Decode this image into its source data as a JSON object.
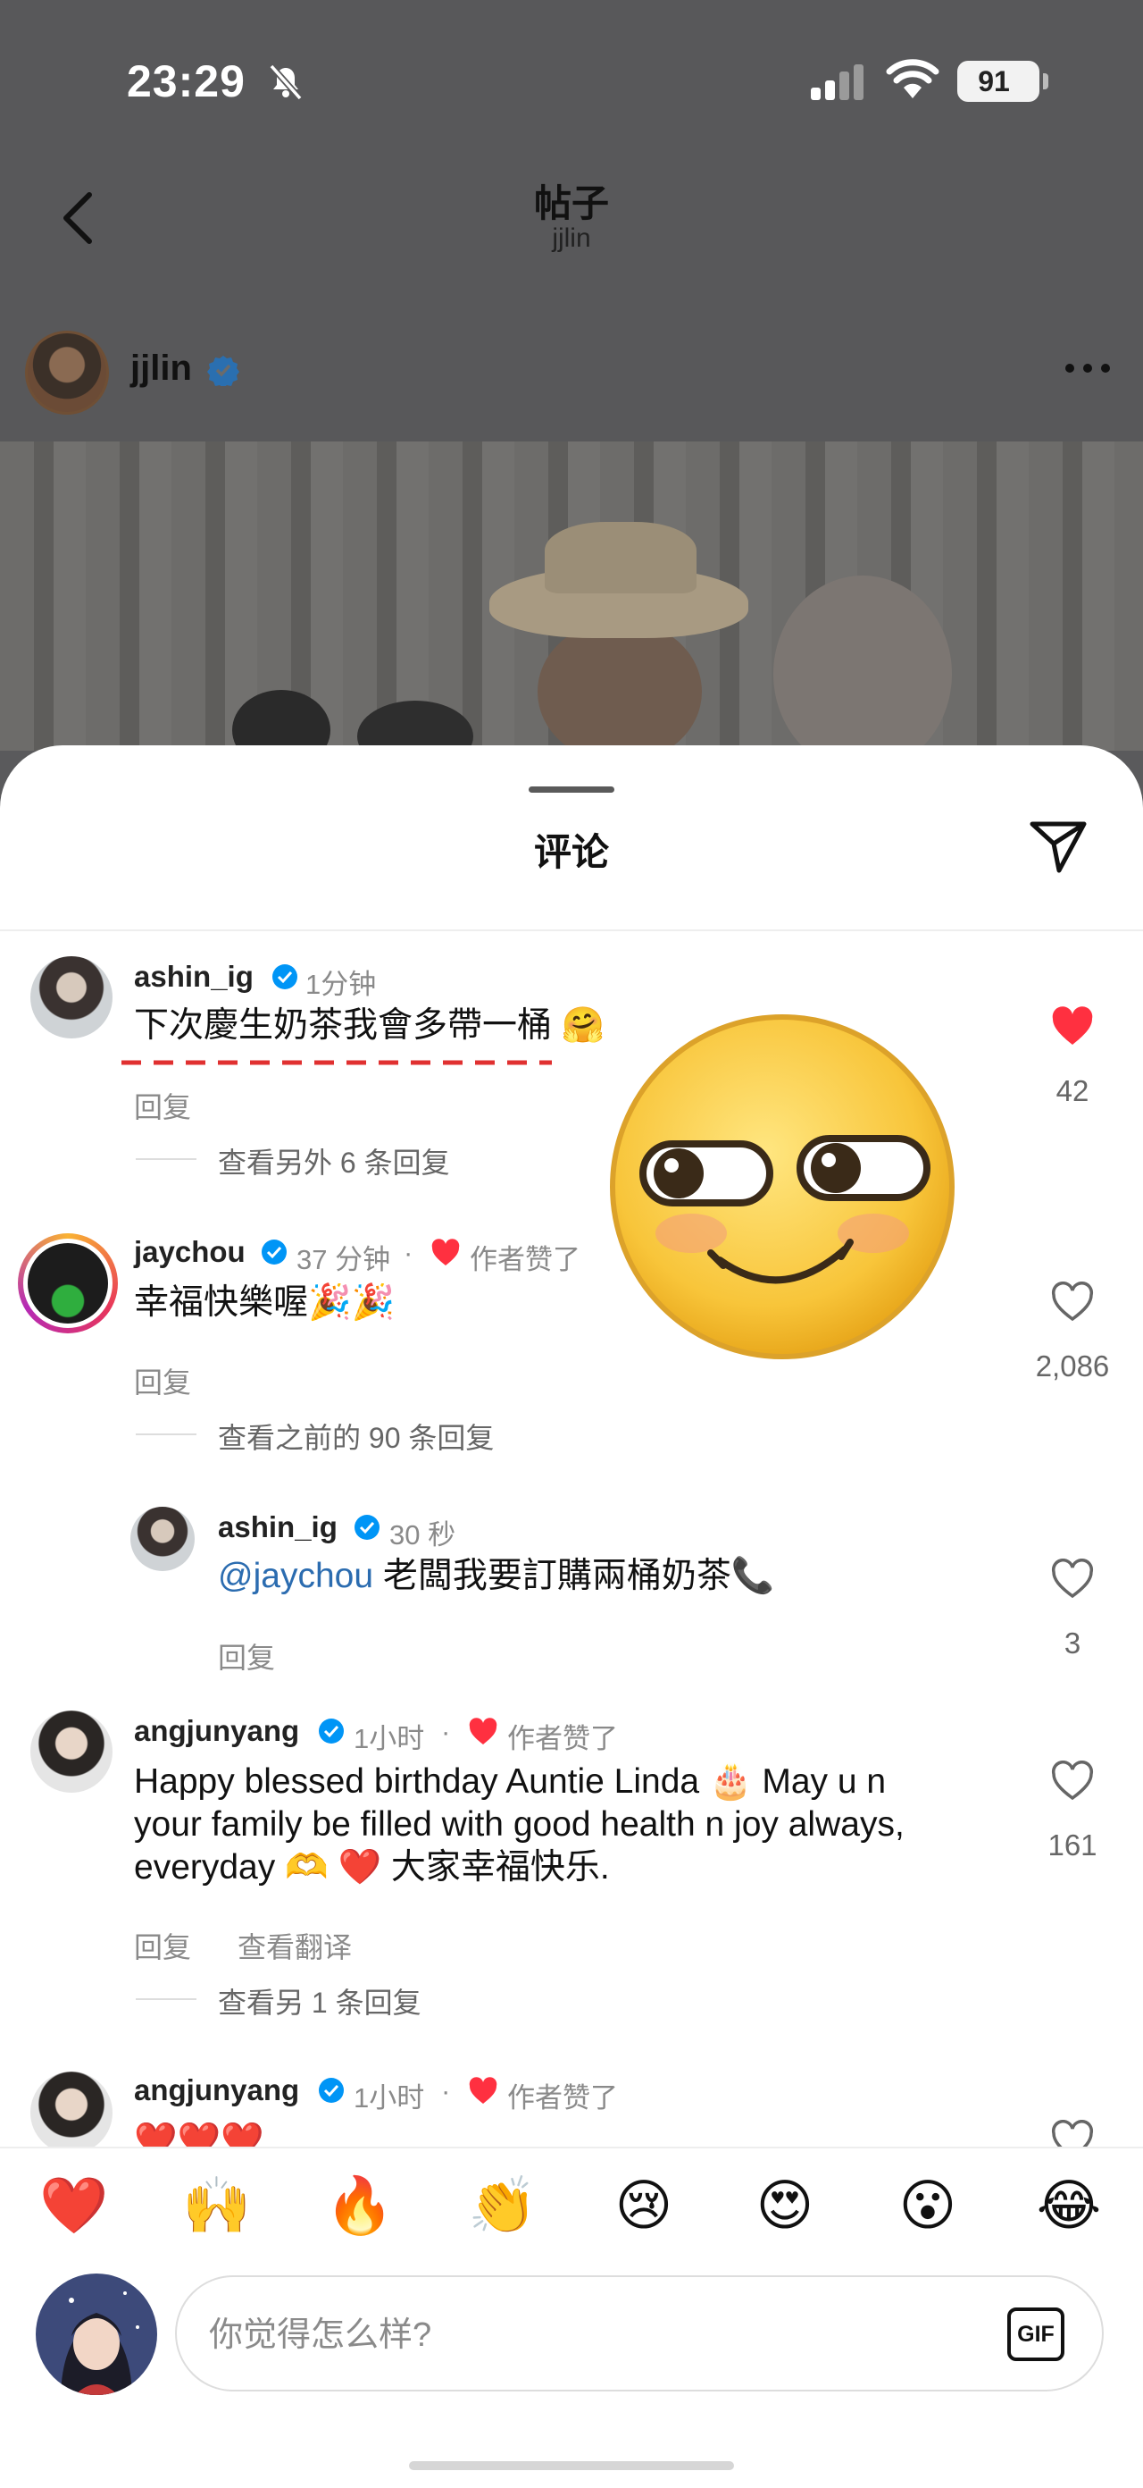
{
  "status_bar": {
    "time": "23:29",
    "battery": "91"
  },
  "nav": {
    "title": "帖子",
    "subtitle": "jjlin"
  },
  "post": {
    "username": "jjlin"
  },
  "sheet": {
    "title": "评论"
  },
  "comments": [
    {
      "username": "ashin_ig",
      "time": "1分钟",
      "text": "下次慶生奶茶我會多帶一桶",
      "text_emoji": "🤗",
      "liked": true,
      "likes": "42",
      "reply_label": "回复",
      "more_replies": "查看另外 6 条回复"
    },
    {
      "username": "jaychou",
      "time": "37 分钟",
      "author_liked": "作者赞了",
      "text": "幸福快樂喔",
      "text_emoji": "🎉🎉",
      "likes": "2,086",
      "reply_label": "回复",
      "more_replies": "查看之前的 90 条回复"
    },
    {
      "username": "angjunyang",
      "time": "1小时",
      "author_liked": "作者赞了",
      "text_lines": [
        "Happy blessed birthday Auntie Linda 🎂 May u n",
        "your family be filled with good health n joy always,",
        "everyday 🫶 ❤️ 大家幸福快乐."
      ],
      "likes": "161",
      "reply_label": "回复",
      "translate_label": "查看翻译",
      "more_replies": "查看另 1 条回复"
    },
    {
      "username": "angjunyang",
      "time": "1小时",
      "author_liked": "作者赞了",
      "text": "❤️❤️❤️"
    }
  ],
  "nested_reply": {
    "username": "ashin_ig",
    "time": "30 秒",
    "mention": "@jaychou",
    "text": "老闆我要訂購兩桶奶茶",
    "text_emoji": "📞",
    "likes": "3",
    "reply_label": "回复"
  },
  "reactions": [
    "❤️",
    "🙌",
    "🔥",
    "👏",
    "😢",
    "😍",
    "😮",
    "😂"
  ],
  "composer": {
    "placeholder": "你觉得怎么样?",
    "gif_label": "GIF"
  },
  "colors": {
    "like_red": "#ff3040",
    "verified_blue": "#0095f6",
    "dash_red": "#e03030"
  },
  "icons": [
    "bell-slash-icon",
    "signal-icon",
    "wifi-icon",
    "battery-icon",
    "back-chevron-icon",
    "verified-badge-icon",
    "more-dots-icon",
    "share-send-icon",
    "heart-icon",
    "gif-icon"
  ]
}
